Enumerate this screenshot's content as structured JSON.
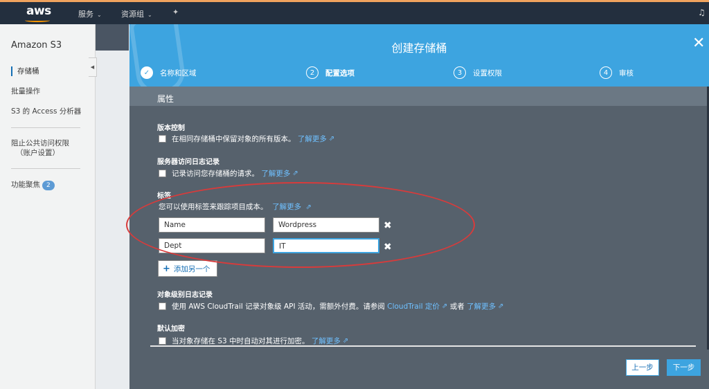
{
  "topnav": {
    "logo": "aws",
    "services": "服务",
    "resource_groups": "资源组"
  },
  "sidebar": {
    "title": "Amazon S3",
    "items": [
      "存储桶",
      "批量操作",
      "S3 的 Access 分析器"
    ],
    "block_public_line1": "阻止公共访问权限",
    "block_public_line2": "（账户设置）",
    "spotlight": "功能聚焦",
    "spotlight_count": "2"
  },
  "modal": {
    "title": "创建存储桶",
    "steps": [
      {
        "num": "✓",
        "label": "名称和区域"
      },
      {
        "num": "2",
        "label": "配置选项"
      },
      {
        "num": "3",
        "label": "设置权限"
      },
      {
        "num": "4",
        "label": "审核"
      }
    ],
    "section_title": "属性",
    "versioning": {
      "title": "版本控制",
      "text": "在相同存储桶中保留对象的所有版本。",
      "link": "了解更多"
    },
    "access_logging": {
      "title": "服务器访问日志记录",
      "text": "记录访问您存储桶的请求。",
      "link": "了解更多"
    },
    "tags": {
      "title": "标签",
      "desc": "您可以使用标签来跟踪项目成本。",
      "link": "了解更多",
      "rows": [
        {
          "key": "Name",
          "value": "Wordpress"
        },
        {
          "key": "Dept",
          "value": "IT"
        }
      ],
      "add_label": "添加另一个"
    },
    "object_logging": {
      "title": "对象级别日志记录",
      "text": "使用 AWS CloudTrail 记录对象级 API 活动，需额外付费。请参阅",
      "link1": "CloudTrail 定价",
      "or": "或者",
      "link2": "了解更多"
    },
    "encryption": {
      "title": "默认加密",
      "text": "当对象存储在 S3 中时自动对其进行加密。",
      "link": "了解更多"
    },
    "prev_label": "上一步",
    "next_label": "下一步"
  },
  "colors": {
    "header_blue": "#3da4e0",
    "nav_dark": "#232f3e",
    "annotation_red": "#d83b3b"
  }
}
